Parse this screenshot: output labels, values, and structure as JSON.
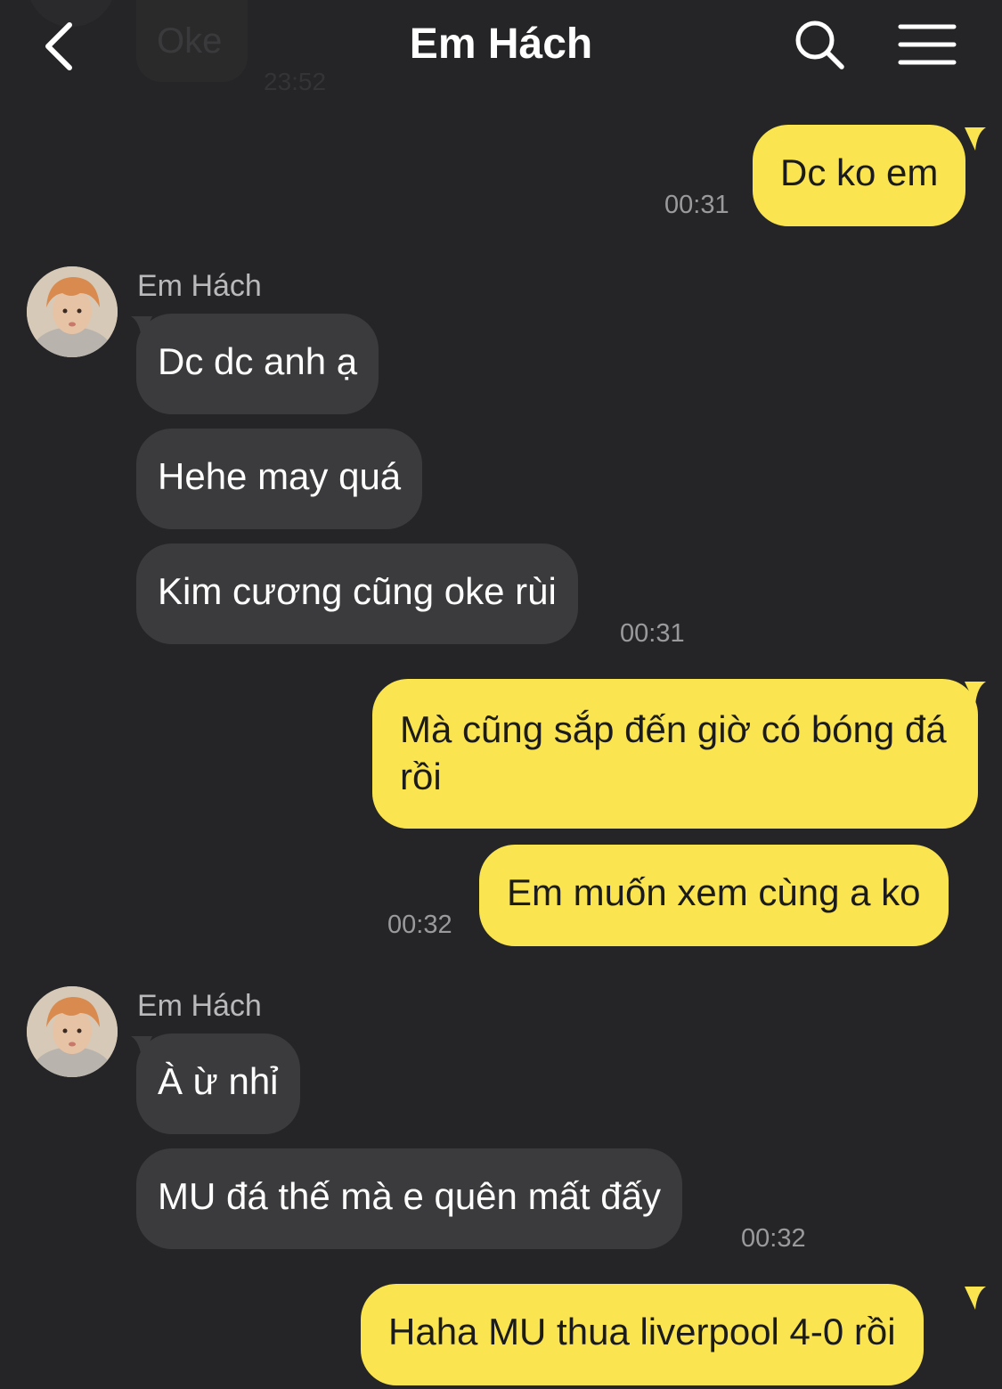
{
  "header": {
    "title": "Em Hách"
  },
  "ghost": {
    "text": "Oke",
    "time": "23:52"
  },
  "messages": {
    "m1": {
      "text": "Dc ko em",
      "time": "00:31"
    },
    "g1": {
      "sender": "Em Hách",
      "b1": "Dc dc anh ạ",
      "b2": "Hehe may quá",
      "b3": "Kim cương cũng oke rùi",
      "time": "00:31"
    },
    "m2": {
      "text": "Mà cũng sắp đến giờ có bóng đá rồi"
    },
    "m3": {
      "text": "Em muốn xem cùng a ko",
      "time": "00:32"
    },
    "g2": {
      "sender": "Em Hách",
      "b1": "À ừ nhỉ",
      "b2": "MU đá thế mà e quên mất đấy",
      "time": "00:32"
    },
    "m4": {
      "text": "Haha MU thua liverpool 4-0 rồi"
    }
  },
  "colors": {
    "background": "#252527",
    "outgoing_bubble": "#fae551",
    "incoming_bubble": "#3b3b3d"
  },
  "icons": [
    "back-icon",
    "search-icon",
    "menu-icon"
  ]
}
